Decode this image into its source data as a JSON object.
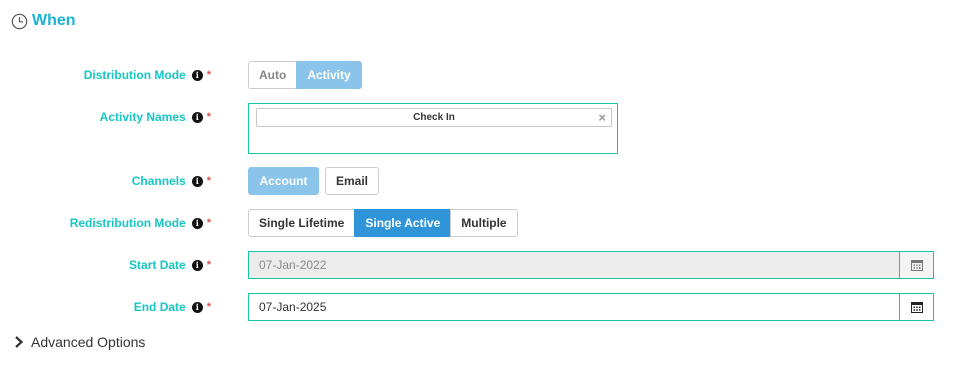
{
  "section": {
    "title": "When",
    "icon": "clock-icon"
  },
  "colors": {
    "label": "#17c5c5",
    "title": "#1ab3d6",
    "active": "#2f94d8",
    "active_light": "#8bc4ea",
    "field_border": "#17c5a5"
  },
  "distribution_mode": {
    "label": "Distribution Mode",
    "options": [
      "Auto",
      "Activity"
    ],
    "selected": "Activity"
  },
  "activity_names": {
    "label": "Activity Names",
    "tags": [
      "Check In"
    ]
  },
  "channels": {
    "label": "Channels",
    "options": [
      "Account",
      "Email"
    ],
    "selected": "Account"
  },
  "redistribution_mode": {
    "label": "Redistribution Mode",
    "options": [
      "Single Lifetime",
      "Single Active",
      "Multiple"
    ],
    "selected": "Single Active"
  },
  "start_date": {
    "label": "Start Date",
    "value": "07-Jan-2022",
    "disabled": true
  },
  "end_date": {
    "label": "End Date",
    "value": "07-Jan-2025"
  },
  "advanced": {
    "label": "Advanced Options"
  },
  "required_marker": "*",
  "info_glyph": "i"
}
